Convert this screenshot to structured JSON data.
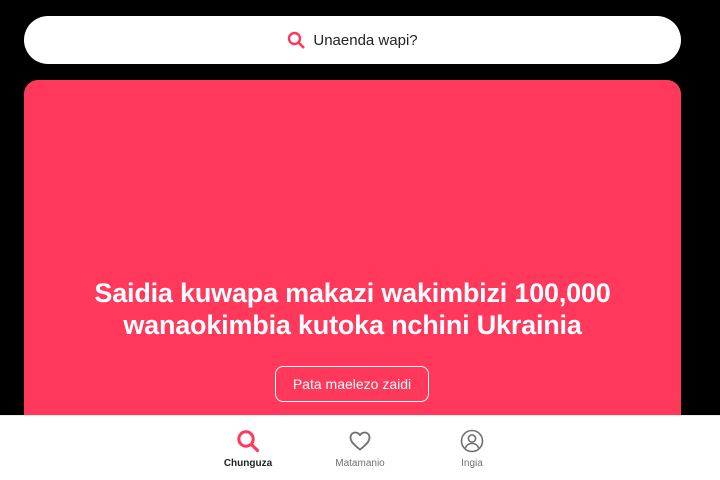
{
  "search": {
    "placeholder": "Unaenda wapi?",
    "icon": "search-icon"
  },
  "hero": {
    "title_line1": "Saidia kuwapa makazi wakimbizi 100,000",
    "title_line2": "wanaokimbia kutoka nchini Ukrainia",
    "button_label": "Pata maelezo zaidi",
    "background_color": "#ff385c"
  },
  "bottom_nav": {
    "items": [
      {
        "label": "Chunguza",
        "icon": "search-icon",
        "active": true
      },
      {
        "label": "Matamanio",
        "icon": "heart-icon",
        "active": false
      },
      {
        "label": "Ingia",
        "icon": "user-circle-icon",
        "active": false
      }
    ]
  },
  "colors": {
    "accent": "#ff385c",
    "text": "#222222",
    "muted": "#717171"
  }
}
